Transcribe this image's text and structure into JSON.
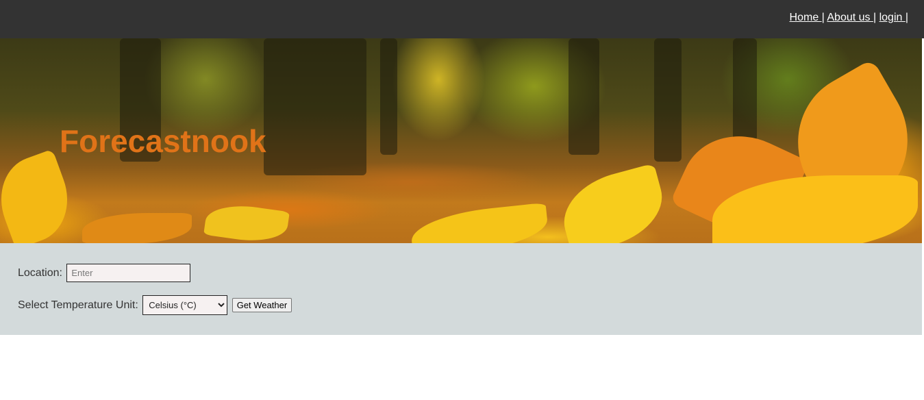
{
  "nav": {
    "items": [
      {
        "label": "Home "
      },
      {
        "label": "About us "
      },
      {
        "label": "login "
      }
    ],
    "separator": "|"
  },
  "hero": {
    "brand": "Forecastnook"
  },
  "form": {
    "location_label": "Location:",
    "location_placeholder": "Enter",
    "unit_label": "Select Temperature Unit:",
    "unit_selected": "Celsius (°C)",
    "submit_label": "Get Weather"
  },
  "colors": {
    "topbar": "#333333",
    "brand": "#e07318",
    "form_panel": "#d3dadb"
  }
}
